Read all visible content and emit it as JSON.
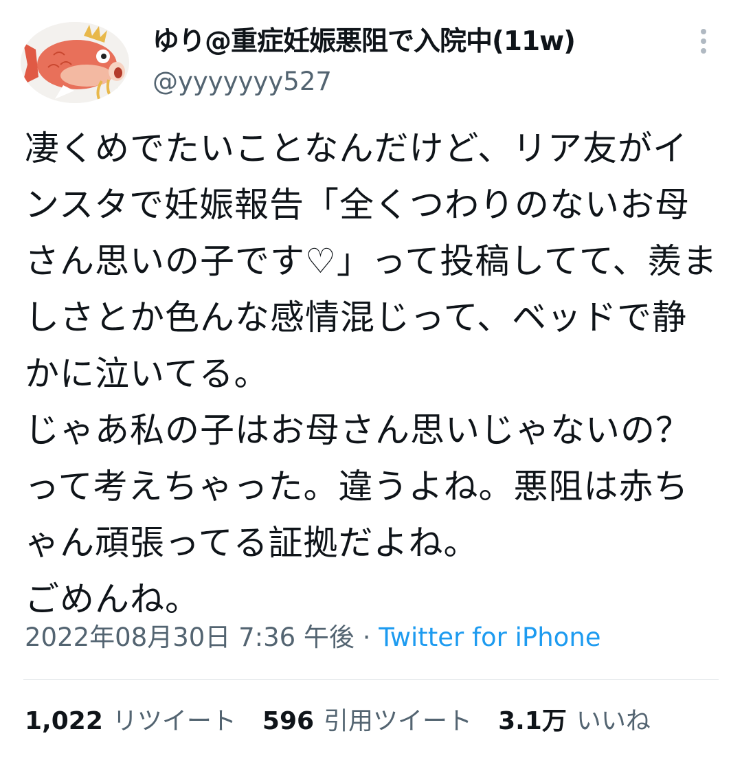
{
  "user": {
    "display_name": "ゆり@重症妊娠悪阻で入院中(11w)",
    "handle": "@yyyyyyy527",
    "avatar_icon": "magikarp-avatar"
  },
  "more_icon": "more-vertical-icon",
  "tweet": {
    "text": "凄くめでたいことなんだけど、リア友がインスタで妊娠報告「全くつわりのないお母さん思いの子です♡」って投稿してて、羨ましさとか色んな感情混じって、ベッドで静かに泣いてる。\nじゃあ私の子はお母さん思いじゃないの？って考えちゃった。違うよね。悪阻は赤ちゃん頑張ってる証拠だよね。\nごめんね。"
  },
  "meta": {
    "timestamp": "2022年08月30日 7:36 午後",
    "separator": " · ",
    "source": "Twitter for iPhone"
  },
  "stats": {
    "retweets": {
      "count": "1,022",
      "label": "リツイート"
    },
    "quotes": {
      "count": "596",
      "label": "引用ツイート"
    },
    "likes": {
      "count": "3.1万",
      "label": "いいね"
    }
  },
  "colors": {
    "text": "#0f1419",
    "secondary": "#536471",
    "link": "#1d9bf0",
    "divider": "#dfe3e6"
  }
}
